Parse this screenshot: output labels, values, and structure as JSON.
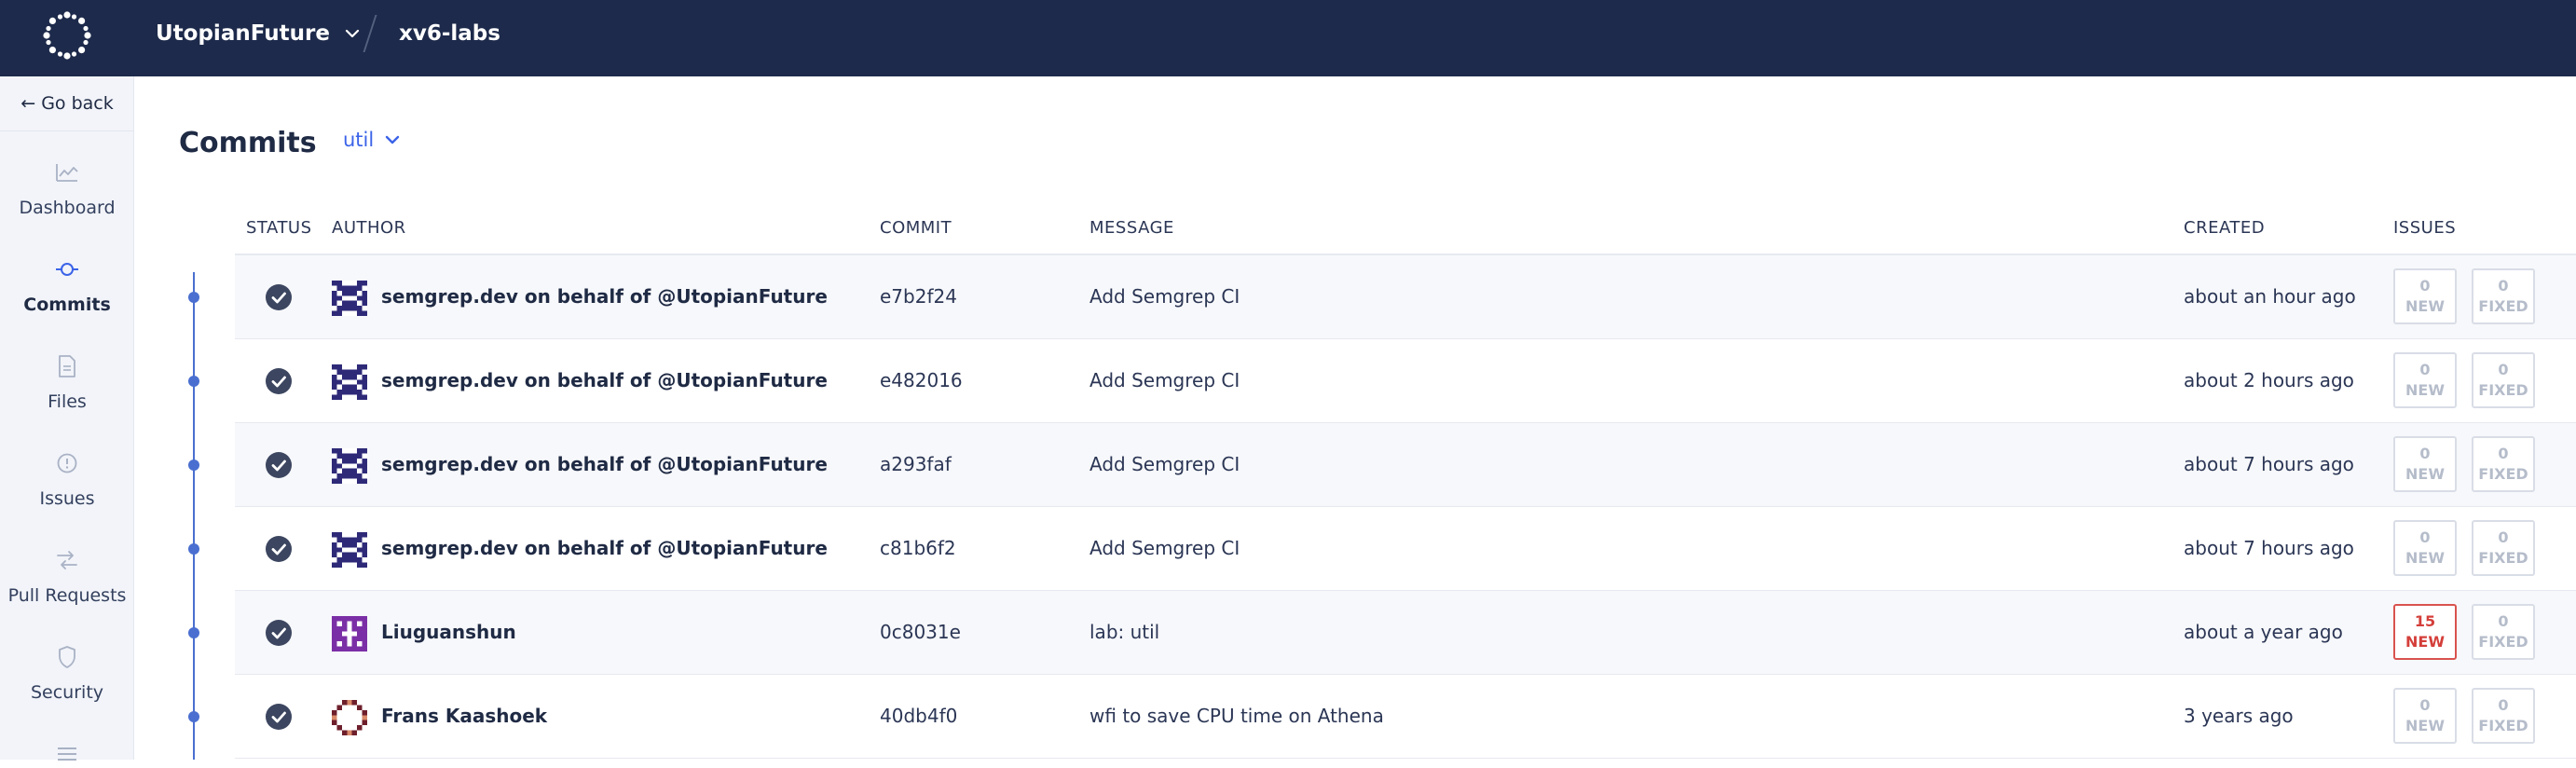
{
  "header": {
    "org": "UtopianFuture",
    "repo": "xv6-labs"
  },
  "sidebar": {
    "go_back": "← Go back",
    "items": [
      {
        "label": "Dashboard",
        "icon": "dashboard-icon"
      },
      {
        "label": "Commits",
        "icon": "commit-icon"
      },
      {
        "label": "Files",
        "icon": "file-icon"
      },
      {
        "label": "Issues",
        "icon": "issue-icon"
      },
      {
        "label": "Pull Requests",
        "icon": "pull-request-icon"
      },
      {
        "label": "Security",
        "icon": "shield-icon"
      }
    ]
  },
  "page": {
    "title": "Commits",
    "branch": "util"
  },
  "table": {
    "headers": {
      "status": "STATUS",
      "author": "AUTHOR",
      "commit": "COMMIT",
      "message": "MESSAGE",
      "created": "CREATED",
      "issues": "ISSUES"
    },
    "rows": [
      {
        "author": "semgrep.dev on behalf of @UtopianFuture",
        "sha": "e7b2f24",
        "message": "Add Semgrep CI",
        "created": "about an hour ago",
        "new_count": "0",
        "new_label": "NEW",
        "fixed_count": "0",
        "fixed_label": "FIXED"
      },
      {
        "author": "semgrep.dev on behalf of @UtopianFuture",
        "sha": "e482016",
        "message": "Add Semgrep CI",
        "created": "about 2 hours ago",
        "new_count": "0",
        "new_label": "NEW",
        "fixed_count": "0",
        "fixed_label": "FIXED"
      },
      {
        "author": "semgrep.dev on behalf of @UtopianFuture",
        "sha": "a293faf",
        "message": "Add Semgrep CI",
        "created": "about 7 hours ago",
        "new_count": "0",
        "new_label": "NEW",
        "fixed_count": "0",
        "fixed_label": "FIXED"
      },
      {
        "author": "semgrep.dev on behalf of @UtopianFuture",
        "sha": "c81b6f2",
        "message": "Add Semgrep CI",
        "created": "about 7 hours ago",
        "new_count": "0",
        "new_label": "NEW",
        "fixed_count": "0",
        "fixed_label": "FIXED"
      },
      {
        "author": "Liuguanshun",
        "sha": "0c8031e",
        "message": "lab: util",
        "created": "about a year ago",
        "new_count": "15",
        "new_label": "NEW",
        "fixed_count": "0",
        "fixed_label": "FIXED"
      },
      {
        "author": "Frans Kaashoek",
        "sha": "40db4f0",
        "message": "wfi to save CPU time on Athena",
        "created": "3 years ago",
        "new_count": "0",
        "new_label": "NEW",
        "fixed_count": "0",
        "fixed_label": "FIXED"
      }
    ]
  },
  "colors": {
    "header_bg": "#1d2a4b",
    "accent": "#3b63e8",
    "timeline": "#4a6fd0",
    "alert": "#d43f3a"
  }
}
